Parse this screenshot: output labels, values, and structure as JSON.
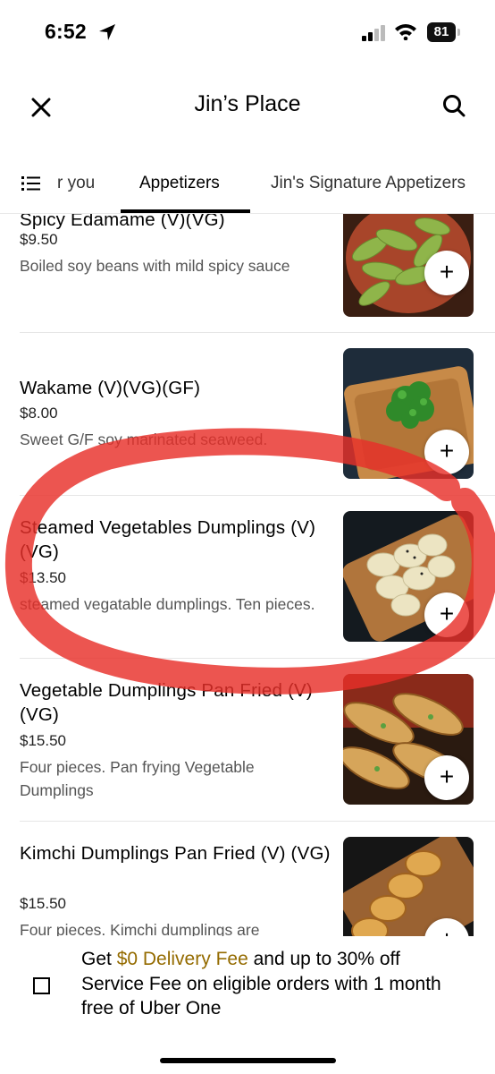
{
  "status": {
    "time": "6:52",
    "battery": "81"
  },
  "header": {
    "title": "Jin’s Place"
  },
  "tabs": [
    {
      "label": "r you"
    },
    {
      "label": "Appetizers"
    },
    {
      "label": "Jin's Signature Appetizers"
    }
  ],
  "items": [
    {
      "name": "Spicy Edamame (V)(VG)",
      "price": "$9.50",
      "desc": "Boiled soy beans with mild spicy sauce"
    },
    {
      "name": "Wakame (V)(VG)(GF)",
      "price": "$8.00",
      "desc": "Sweet G/F soy marinated seaweed."
    },
    {
      "name": "Steamed Vegetables Dumplings (V)(VG)",
      "price": "$13.50",
      "desc": "steamed vegatable dumplings. Ten pieces."
    },
    {
      "name": "Vegetable Dumplings Pan Fried (V)(VG)",
      "price": "$15.50",
      "desc": "Four pieces. Pan frying Vegetable Dumplings"
    },
    {
      "name": "Kimchi Dumplings Pan Fried (V) (VG)",
      "price": "$15.50",
      "desc": "Four pieces. Kimchi dumplings are"
    }
  ],
  "add_label": "+",
  "promo": {
    "pre": "Get ",
    "highlight": "$0 Delivery Fee",
    "post": " and up to 30% off Service Fee on eligible orders with 1 month free of Uber One"
  },
  "colors": {
    "highlight": "#946b00",
    "annotation": "#e8302a"
  },
  "icons": [
    "location-arrow-icon",
    "signal-icon",
    "wifi-icon",
    "battery-icon",
    "close-icon",
    "search-icon",
    "menu-list-icon",
    "checkbox-icon"
  ]
}
